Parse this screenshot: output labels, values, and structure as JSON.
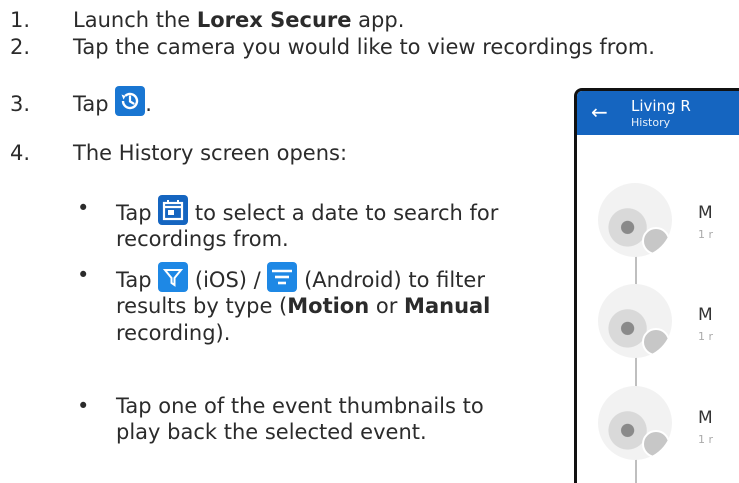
{
  "steps": [
    {
      "num": "1.",
      "pre": "Launch the ",
      "bold": "Lorex Secure",
      "post": " app."
    },
    {
      "num": "2.",
      "text": "Tap the camera you would like to view recordings from."
    },
    {
      "num": "3.",
      "pre": "Tap ",
      "post": "."
    },
    {
      "num": "4.",
      "text": "The History screen opens:"
    }
  ],
  "bullets": [
    {
      "pre": "Tap ",
      "post": " to select a date to search for recordings from."
    },
    {
      "pre": "Tap ",
      "mid1": " (iOS) / ",
      "mid2": " (Android) to filter results by type (",
      "b1": "Motion",
      "mid3": " or ",
      "b2": "Manual",
      "post": " recording)."
    },
    {
      "text": "Tap one of the event thumbnails to play back the selected event."
    }
  ],
  "bullet_glyph": "•",
  "icons": {
    "history": "history-icon",
    "calendar": "calendar-icon",
    "filter_ios": "filter-icon",
    "filter_android": "sort-icon",
    "color": "#1976d2"
  },
  "phone": {
    "back_glyph": "←",
    "title": "Living R",
    "subtitle": "History",
    "events": [
      {
        "title": "M",
        "sub": "1 r"
      },
      {
        "title": "M",
        "sub": "1 r"
      },
      {
        "title": "M",
        "sub": "1 r"
      }
    ]
  }
}
